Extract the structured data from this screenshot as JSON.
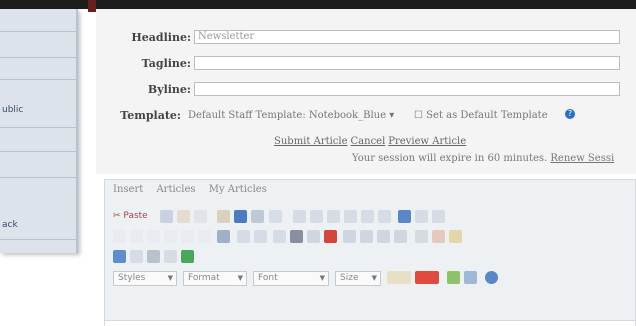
{
  "sidebar": {
    "items": [
      {
        "label": ""
      },
      {
        "label": ""
      },
      {
        "label": "ublic"
      },
      {
        "label": ""
      },
      {
        "label": ""
      },
      {
        "label": "ack"
      }
    ]
  },
  "form": {
    "headline_label": "Headline:",
    "headline_value": "Newsletter",
    "tagline_label": "Tagline:",
    "tagline_value": "",
    "byline_label": "Byline:",
    "byline_value": "",
    "template_label": "Template:",
    "template_value": "Default Staff Template: Notebook_Blue",
    "default_template_label": "Set as Default Template",
    "actions": {
      "submit": "Submit Article",
      "cancel": "Cancel",
      "preview": "Preview Article"
    },
    "session_text": "Your session will expire in 60 minutes.",
    "session_link": "Renew Sessi"
  },
  "editor": {
    "tabs": [
      "Insert",
      "Articles",
      "My Articles"
    ],
    "toolbar1_first": "Paste",
    "combos": [
      {
        "label": "Styles"
      },
      {
        "label": "Format"
      },
      {
        "label": "Font"
      },
      {
        "label": "Size"
      }
    ]
  },
  "colors": {
    "help_icon": "#2a6fc9",
    "sidebar_bg": "#dde3ea",
    "editor_bg": "#eef1f4"
  }
}
